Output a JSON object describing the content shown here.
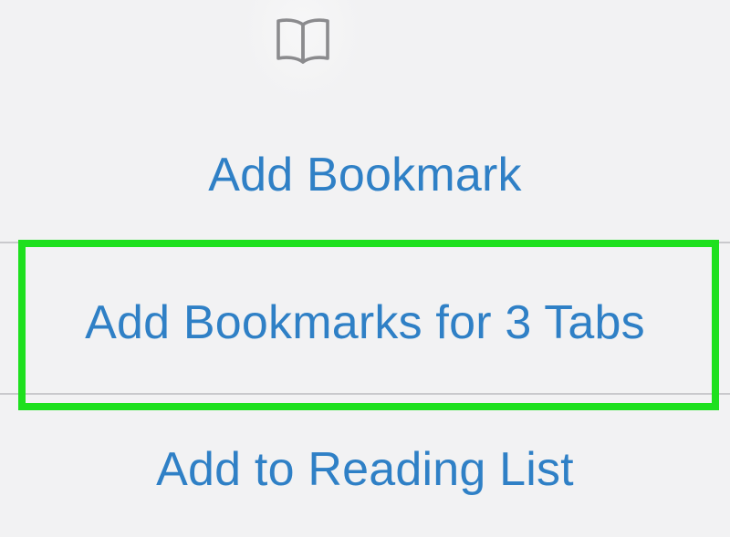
{
  "colors": {
    "accent": "#2f80c6",
    "background": "#f2f2f3",
    "separator": "#c9c9cc",
    "icon": "#8b8b8e",
    "highlight": "#1ee01e"
  },
  "header": {
    "icon": "book-icon"
  },
  "menu": {
    "items": [
      {
        "label": "Add Bookmark"
      },
      {
        "label": "Add Bookmarks for 3 Tabs"
      },
      {
        "label": "Add to Reading List"
      }
    ]
  }
}
